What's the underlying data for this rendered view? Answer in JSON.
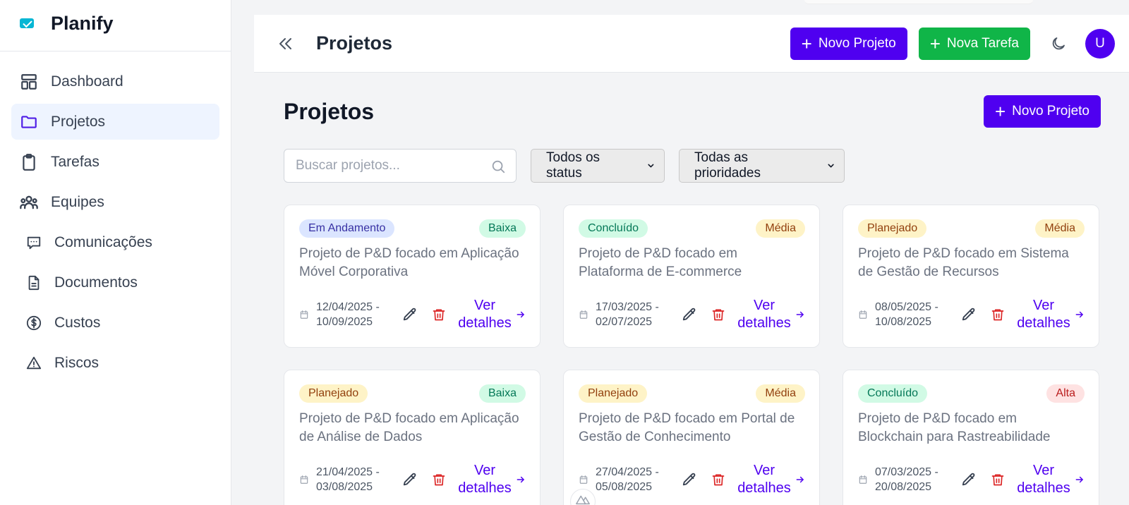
{
  "app": {
    "name": "Planify"
  },
  "sidebar": {
    "items": [
      {
        "label": "Dashboard",
        "icon": "dashboard-layout-icon"
      },
      {
        "label": "Projetos",
        "icon": "folder-icon",
        "active": true
      },
      {
        "label": "Tarefas",
        "icon": "clipboard-icon"
      },
      {
        "label": "Equipes",
        "icon": "users-icon"
      },
      {
        "label": "Comunicações",
        "icon": "message-icon"
      },
      {
        "label": "Documentos",
        "icon": "document-icon"
      },
      {
        "label": "Custos",
        "icon": "dollar-circle-icon"
      },
      {
        "label": "Riscos",
        "icon": "warning-triangle-icon"
      }
    ]
  },
  "header": {
    "title": "Projetos",
    "new_project_label": "Novo Projeto",
    "new_task_label": "Nova Tarefa",
    "avatar_initial": "U"
  },
  "main": {
    "title": "Projetos",
    "new_project_label": "Novo Projeto",
    "search_placeholder": "Buscar projetos...",
    "status_filter": "Todos os status",
    "priority_filter": "Todas as prioridades",
    "details_label": "Ver detalhes",
    "projects": [
      {
        "status": "Em Andamento",
        "priority": "Baixa",
        "description": "Projeto de P&D focado em Aplicação Móvel Corporativa",
        "start": "12/04/2025 -",
        "end": "10/09/2025"
      },
      {
        "status": "Concluído",
        "priority": "Média",
        "description": "Projeto de P&D focado em Plataforma de E-commerce",
        "start": "17/03/2025 -",
        "end": "02/07/2025"
      },
      {
        "status": "Planejado",
        "priority": "Média",
        "description": "Projeto de P&D focado em Sistema de Gestão de Recursos",
        "start": "08/05/2025 -",
        "end": "10/08/2025"
      },
      {
        "status": "Planejado",
        "priority": "Baixa",
        "description": "Projeto de P&D focado em Aplicação de Análise de Dados",
        "start": "21/04/2025 -",
        "end": "03/08/2025"
      },
      {
        "status": "Planejado",
        "priority": "Média",
        "description": "Projeto de P&D focado em Portal de Gestão de Conhecimento",
        "start": "27/04/2025 -",
        "end": "05/08/2025"
      },
      {
        "status": "Concluído",
        "priority": "Alta",
        "description": "Projeto de P&D focado em Blockchain para Rastreabilidade",
        "start": "07/03/2025 -",
        "end": "20/08/2025"
      }
    ]
  },
  "colors": {
    "primary": "#4f00f0",
    "success": "#10b548",
    "status": {
      "Em Andamento": {
        "bg": "#dbe5ff",
        "fg": "#3730a3"
      },
      "Concluído": {
        "bg": "#d1fae5",
        "fg": "#047857"
      },
      "Planejado": {
        "bg": "#fef3c7",
        "fg": "#92400e"
      }
    },
    "priority": {
      "Baixa": {
        "bg": "#d1fae5",
        "fg": "#047857"
      },
      "Média": {
        "bg": "#fef3c7",
        "fg": "#92400e"
      },
      "Alta": {
        "bg": "#fee2e2",
        "fg": "#b91c1c"
      }
    }
  }
}
